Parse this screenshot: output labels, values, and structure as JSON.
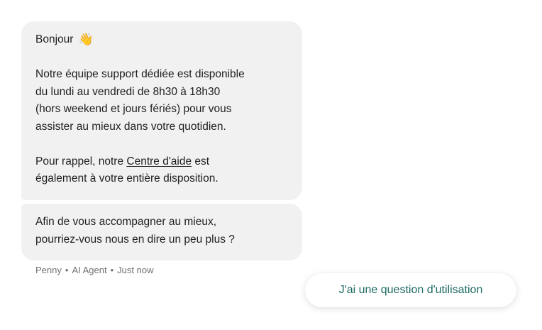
{
  "messages": [
    {
      "greeting": "Bonjour",
      "greeting_emoji": "👋",
      "paragraph_1": [
        "Notre équipe support dédiée est disponible",
        "du lundi au vendredi de 8h30 à 18h30",
        "(hors weekend et jours fériés) pour vous",
        "assister au mieux dans votre quotidien."
      ],
      "paragraph_2_prefix": "Pour rappel, notre ",
      "paragraph_2_link": "Centre d'aide",
      "paragraph_2_suffix": " est",
      "paragraph_2_line_2": "également à votre entière disposition."
    },
    {
      "lines": [
        "Afin de vous accompagner au mieux,",
        "pourriez-vous nous en dire un peu plus ?"
      ]
    }
  ],
  "meta": {
    "sender": "Penny",
    "role": "AI Agent",
    "time": "Just now",
    "separator": "•"
  },
  "quick_reply": {
    "label": "J'ai une question d'utilisation"
  },
  "colors": {
    "bubble_bg": "#f1f1f1",
    "quick_reply_text": "#1e6b63"
  }
}
